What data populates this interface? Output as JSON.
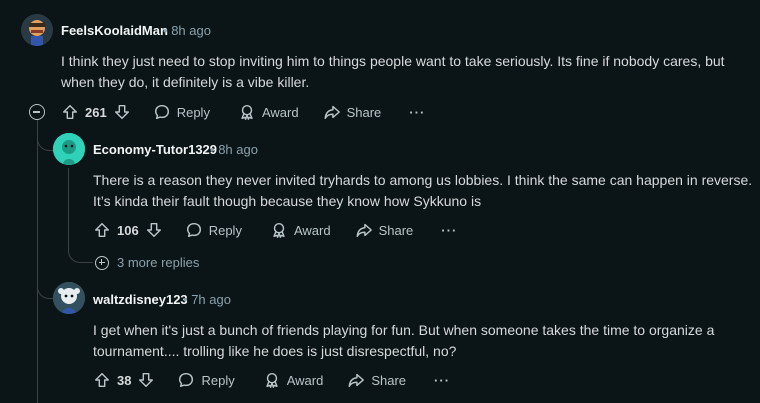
{
  "comments": [
    {
      "author": "FeelsKoolaidMan",
      "time": "8h ago",
      "body": "I think they just need to stop inviting him to things people want to take seriously. Its fine if nobody cares, but when they do, it definitely is a vibe killer.",
      "score": "261",
      "reply_label": "Reply",
      "award_label": "Award",
      "share_label": "Share",
      "more_label": "···",
      "avatar_color": "#e0a060"
    },
    {
      "author": "Economy-Tutor1329",
      "time": "8h ago",
      "body": "There is a reason they never invited tryhards to among us lobbies. I think the same can happen in reverse. It’s kinda their fault though because they know how Sykkuno is",
      "score": "106",
      "reply_label": "Reply",
      "award_label": "Award",
      "share_label": "Share",
      "more_label": "···",
      "avatar_color": "#2fd1b8",
      "more_replies": "3 more replies"
    },
    {
      "author": "waltzdisney123",
      "time": "7h ago",
      "body": "I get when it's just a bunch of friends playing for fun. But when someone takes the time to organize a tournament.... trolling like he does is just disrespectful, no?",
      "score": "38",
      "reply_label": "Reply",
      "award_label": "Award",
      "share_label": "Share",
      "more_label": "···",
      "avatar_color": "#4a6a7a"
    }
  ],
  "dot": "•"
}
